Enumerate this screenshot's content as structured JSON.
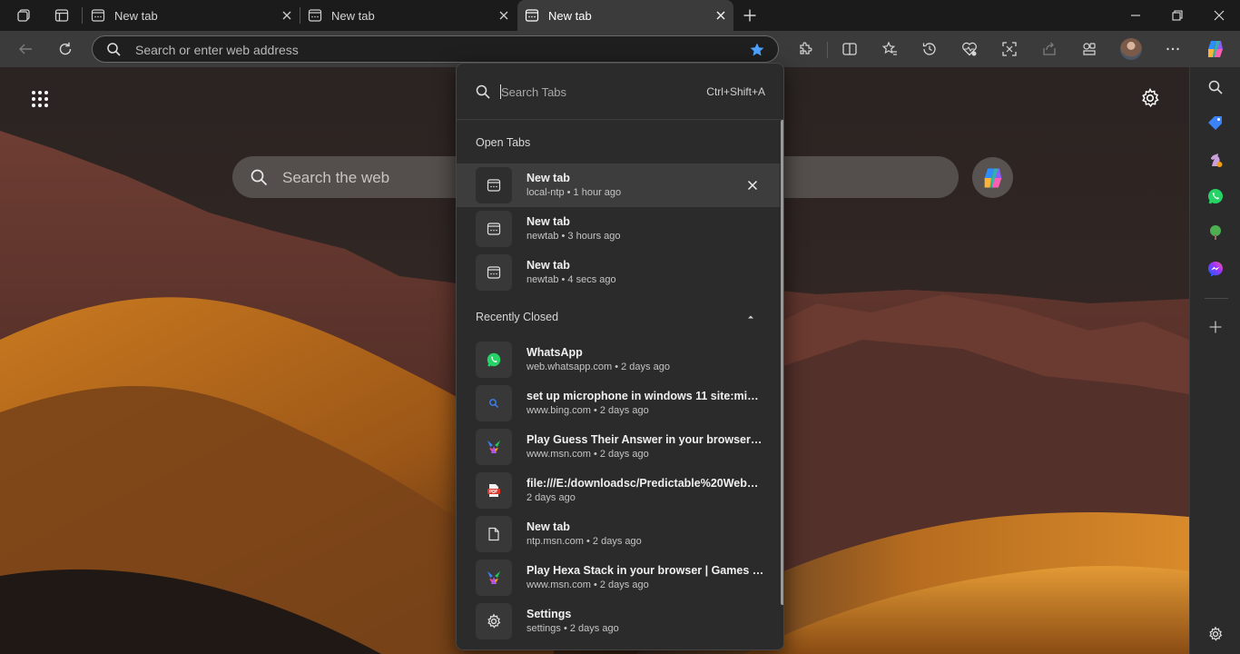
{
  "tabs": [
    {
      "title": "New tab",
      "active": false
    },
    {
      "title": "New tab",
      "active": false
    },
    {
      "title": "New tab",
      "active": true
    }
  ],
  "address_bar": {
    "placeholder": "Search or enter web address"
  },
  "new_tab_page": {
    "search_placeholder": "Search the web"
  },
  "tab_search": {
    "placeholder": "Search Tabs",
    "shortcut": "Ctrl+Shift+A",
    "open_tabs_label": "Open Tabs",
    "recently_closed_label": "Recently Closed",
    "open_tabs": [
      {
        "title": "New tab",
        "subtitle": "local-ntp • 1 hour ago",
        "icon": "newtab-page-icon"
      },
      {
        "title": "New tab",
        "subtitle": "newtab • 3 hours ago",
        "icon": "newtab-page-icon"
      },
      {
        "title": "New tab",
        "subtitle": "newtab • 4 secs ago",
        "icon": "newtab-page-icon"
      }
    ],
    "recently_closed": [
      {
        "title": "WhatsApp",
        "subtitle": "web.whatsapp.com • 2 days ago",
        "icon": "whatsapp-icon"
      },
      {
        "title": "set up microphone in windows 11 site:micros...",
        "subtitle": "www.bing.com • 2 days ago",
        "icon": "bing-search-icon"
      },
      {
        "title": "Play Guess Their Answer in your browser | Ga...",
        "subtitle": "www.msn.com • 2 days ago",
        "icon": "msn-games-icon"
      },
      {
        "title": "file:///E:/downloadsc/Predictable%20Web%2...",
        "subtitle": "2 days ago",
        "icon": "pdf-icon"
      },
      {
        "title": "New tab",
        "subtitle": "ntp.msn.com • 2 days ago",
        "icon": "document-icon"
      },
      {
        "title": "Play Hexa Stack in your browser | Games fro...",
        "subtitle": "www.msn.com • 2 days ago",
        "icon": "msn-games-icon"
      },
      {
        "title": "Settings",
        "subtitle": "settings • 2 days ago",
        "icon": "settings-gear-icon"
      }
    ]
  },
  "colors": {
    "accent_star": "#4da3ff",
    "whatsapp": "#25d366",
    "bing": "#3b82f6"
  }
}
